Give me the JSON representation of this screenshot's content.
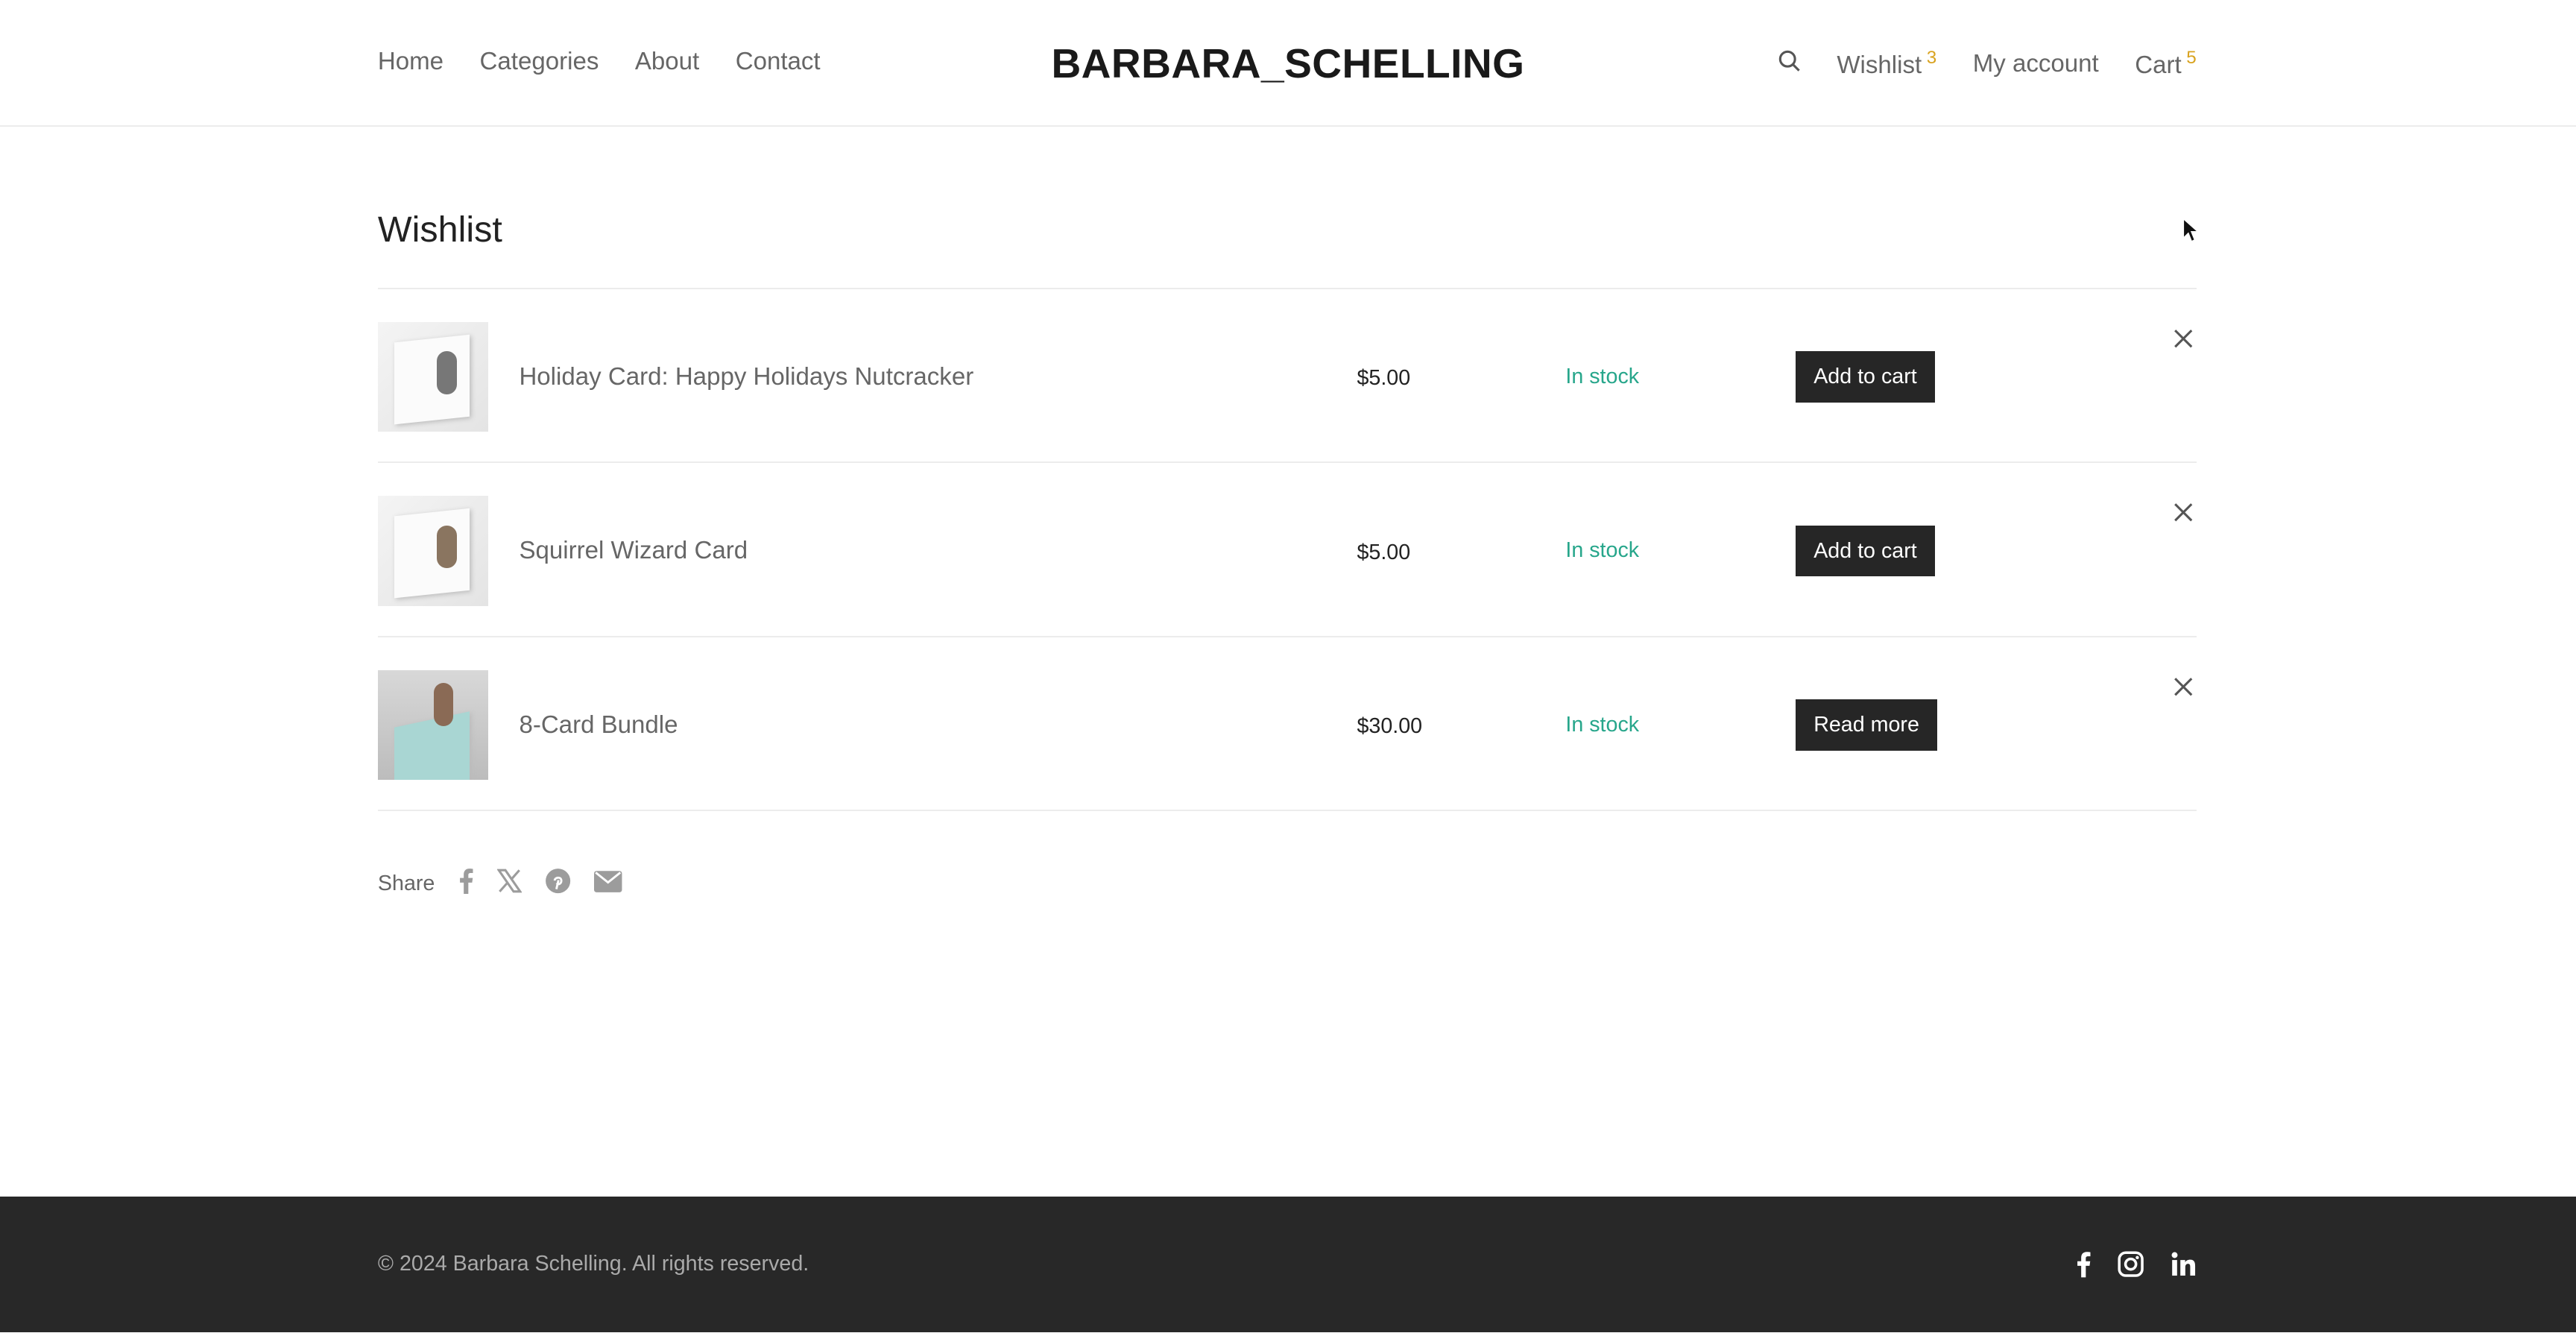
{
  "header": {
    "nav_left": [
      "Home",
      "Categories",
      "About",
      "Contact"
    ],
    "logo": "BARBARA_SCHELLING",
    "wishlist": "Wishlist",
    "wishlist_count": "3",
    "account": "My account",
    "cart": "Cart",
    "cart_count": "5"
  },
  "page": {
    "title": "Wishlist"
  },
  "items": [
    {
      "name": "Holiday Card: Happy Holidays Nutcracker",
      "price": "$5.00",
      "stock": "In stock",
      "action": "Add to cart"
    },
    {
      "name": "Squirrel Wizard Card",
      "price": "$5.00",
      "stock": "In stock",
      "action": "Add to cart"
    },
    {
      "name": "8-Card Bundle",
      "price": "$30.00",
      "stock": "In stock",
      "action": "Read more"
    }
  ],
  "share": {
    "label": "Share",
    "icons": [
      "facebook-icon",
      "x-icon",
      "pinterest-icon",
      "email-icon"
    ]
  },
  "footer": {
    "copyright": "© 2024 Barbara Schelling. All rights reserved.",
    "icons": [
      "facebook-icon",
      "instagram-icon",
      "linkedin-icon"
    ]
  },
  "colors": {
    "accent": "#d9a320",
    "stock": "#27a68b",
    "button": "#262626",
    "footer": "#282828"
  }
}
